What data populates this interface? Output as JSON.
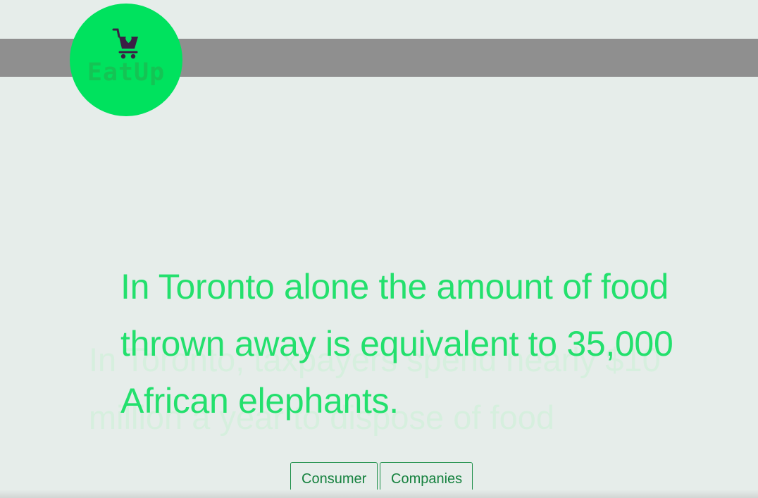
{
  "header": {
    "bar_color": "#8f8f8f"
  },
  "logo": {
    "brand": "EatUp",
    "icon": "shopping-cart-heart-icon",
    "background": "#00e25e"
  },
  "hero": {
    "headline": "In Toronto alone the amount of food thrown away is equivalent to 35,000 African elephants.",
    "faded_text": "In Toronto, taxpayers spend nearly $10 million a year to dispose of food"
  },
  "buttons": {
    "consumer": "Consumer",
    "companies": "Companies"
  },
  "colors": {
    "accent": "#23e06d",
    "button_text": "#16823f",
    "page_background": "#e6edea"
  }
}
